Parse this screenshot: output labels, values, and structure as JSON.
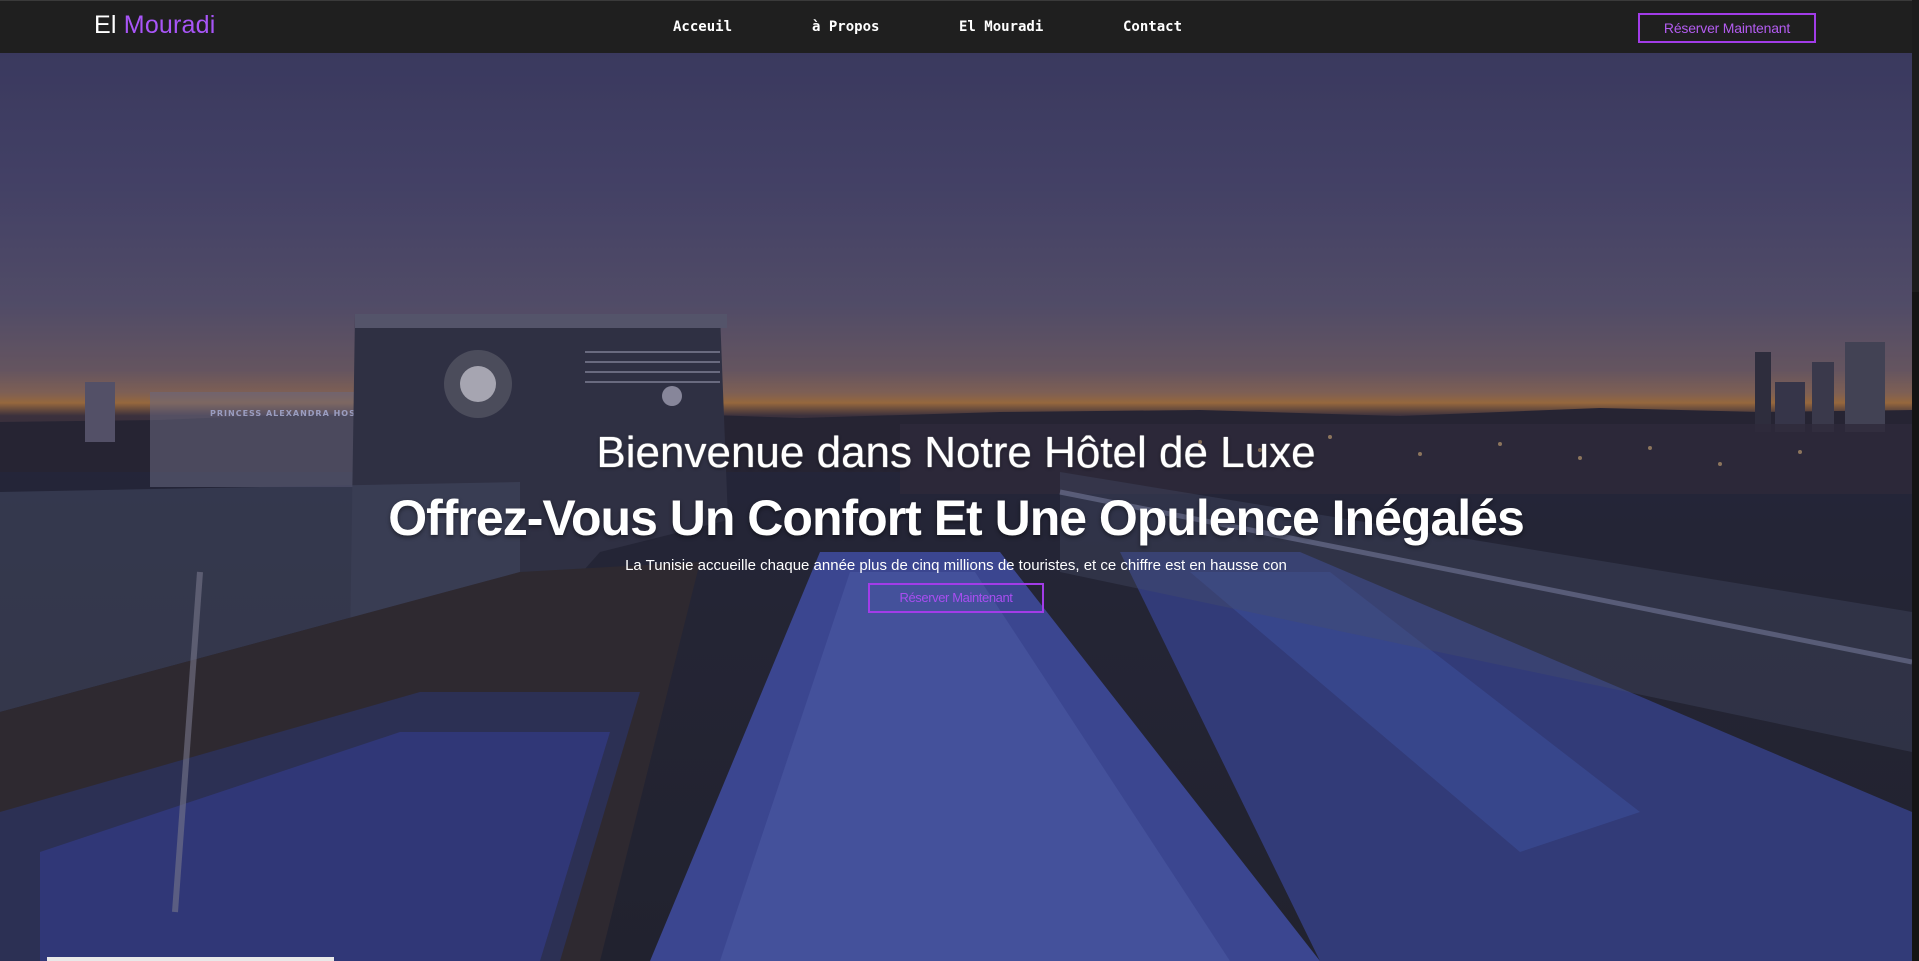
{
  "brand": {
    "first": "El",
    "second": "Mouradi",
    "accent_color": "#a855f7"
  },
  "nav": {
    "links": [
      "Acceuil",
      "à Propos",
      "El Mouradi",
      "Contact"
    ],
    "cta_label": "Réserver Maintenant"
  },
  "hero": {
    "welcome": "Bienvenue dans Notre Hôtel de Luxe",
    "headline": "Offrez-Vous Un Confort Et Une Opulence Inégalés",
    "tagline": "La Tunisie accueille chaque année plus de cinq millions de touristes, et ce chiffre est en hausse con",
    "cta_label": "Réserver Maintenant",
    "background_sign": "PRINCESS ALEXANDRA HOSPITAL"
  },
  "colors": {
    "navbar_bg": "#1f1f1f",
    "accent": "#a23ce8"
  }
}
